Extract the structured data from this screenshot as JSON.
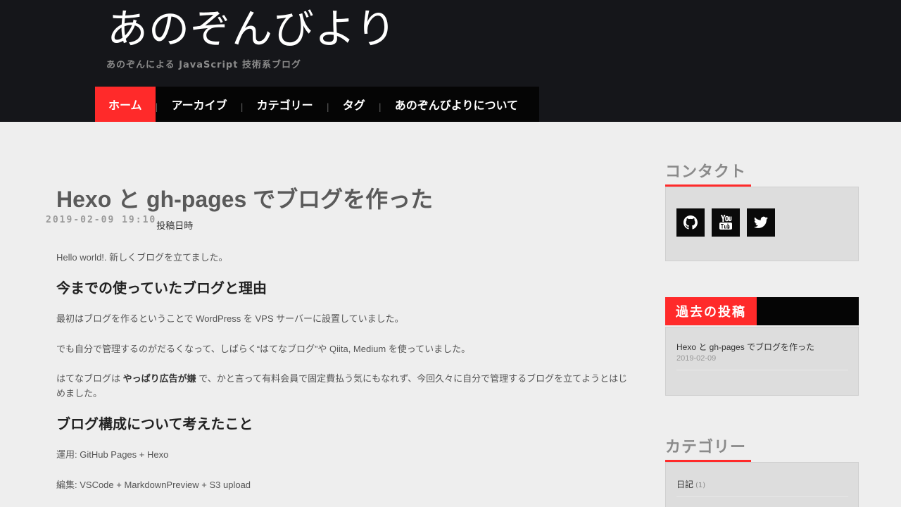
{
  "site": {
    "title": "あのぞんびより",
    "description": "あのぞんによる JavaScript 技術系ブログ"
  },
  "nav": {
    "items": [
      {
        "label": "ホーム",
        "active": true
      },
      {
        "label": "アーカイブ"
      },
      {
        "label": "カテゴリー"
      },
      {
        "label": "タグ"
      },
      {
        "label": "あのぞんびよりについて"
      }
    ],
    "separator": "|"
  },
  "post": {
    "title": "Hexo と gh-pages でブログを作った",
    "date": "2019-02-09 19:10",
    "date_label": "投稿日時",
    "intro": "Hello world!. 新しくブログを立てました。",
    "h2_1": "今までの使っていたブログと理由",
    "p1": "最初はブログを作るということで WordPress を VPS サーバーに設置していました。",
    "p2": "でも自分で管理するのがだるくなって、しばらく“はてなブログ”や Qiita, Medium を使っていました。",
    "p3_before": "はてなブログは ",
    "p3_strong": "やっぱり広告が嫌",
    "p3_after": " で、かと言って有料会員で固定費払う気にもなれず、今回久々に自分で管理するブログを立てようとはじめました。",
    "h2_2": "ブログ構成について考えたこと",
    "p4": "運用: GitHub Pages + Hexo",
    "p5": "編集: VSCode + MarkdownPreview + S3 upload"
  },
  "sidebar": {
    "contact": {
      "heading": "コンタクト",
      "links": [
        {
          "icon": "github-icon",
          "name": "GitHub"
        },
        {
          "icon": "youtube-icon",
          "name": "YouTube"
        },
        {
          "icon": "twitter-icon",
          "name": "Twitter"
        }
      ]
    },
    "past_posts": {
      "heading": "過去の投稿",
      "items": [
        {
          "title": "Hexo と gh-pages でブログを作った",
          "date": "2019-02-09"
        }
      ]
    },
    "categories": {
      "heading": "カテゴリー",
      "items": [
        {
          "label": "日記",
          "count": "(1)"
        }
      ]
    }
  },
  "colors": {
    "header_bg": "#15161a",
    "nav_bg": "#050505",
    "accent": "#ff2a2a",
    "page_bg": "#eeeeee",
    "widget_bg": "#dddddd"
  }
}
